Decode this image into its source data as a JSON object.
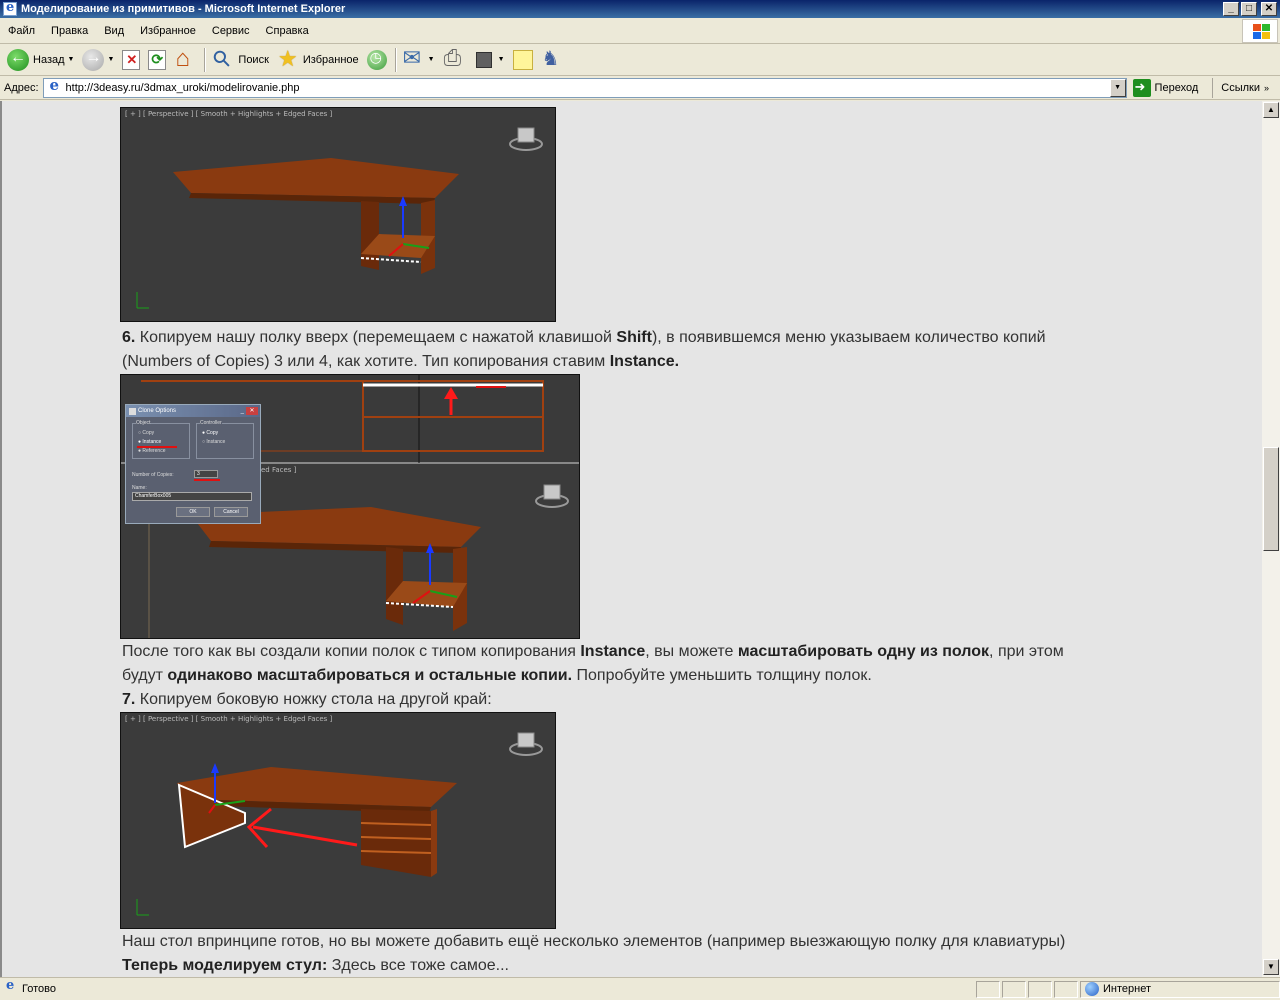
{
  "window": {
    "title": "Моделирование из примитивов - Microsoft Internet Explorer",
    "controls": [
      "_",
      "□",
      "✕"
    ]
  },
  "menu": [
    {
      "label": "Файл"
    },
    {
      "label": "Правка"
    },
    {
      "label": "Вид"
    },
    {
      "label": "Избранное"
    },
    {
      "label": "Сервис"
    },
    {
      "label": "Справка"
    }
  ],
  "toolbar": {
    "back_label": "Назад",
    "search_label": "Поиск",
    "favorites_label": "Избранное"
  },
  "address": {
    "label": "Адрес:",
    "url": "http://3deasy.ru/3dmax_uroki/modelirovanie.php",
    "go_label": "Переход",
    "links_label": "Ссылки"
  },
  "article": {
    "step6_num": "6.",
    "step6_a": " Копируем нашу полку вверх (перемещаем с нажатой клавишой ",
    "step6_shift": "Shift",
    "step6_b": "), в появившемся меню указываем количество копий",
    "step6_line2": "(Numbers of Copies) 3 или 4, как хотите. Тип копирования ставим ",
    "step6_instance": "Instance.",
    "after_a": "После того как вы создали копии полок с типом копирования ",
    "after_instance": "Instance",
    "after_b": ", вы можете ",
    "after_bold1": "масштабировать одну из полок",
    "after_c": ", при этом",
    "after_line2_a": "будут ",
    "after_bold2": "одинаково масштабироваться и остальные копии.",
    "after_line2_b": " Попробуйте уменьшить толщину полок.",
    "step7_num": "7.",
    "step7_text": " Копируем боковую ножку стола на другой край:",
    "final_line": "Наш стол впринципе готов, но вы можете добавить ещё несколько элементов (например выезжающую полку для клавиатуры)",
    "chair_bold": "Теперь моделируем стул:",
    "chair_text": " Здесь все тоже самое..."
  },
  "screenshots": {
    "vp_label": "[ + ] [ Perspective ] [ Smooth + Highlights + Edged Faces ]",
    "vp_label_partial": "ed Faces ]",
    "dialog": {
      "title": "Clone Options",
      "object_group": "Object",
      "opt_copy": "Copy",
      "opt_instance": "Instance",
      "opt_reference": "Reference",
      "controller_group": "Controller",
      "ctrl_copy": "Copy",
      "ctrl_instance": "Instance",
      "copies_label": "Number of Copies:",
      "copies_value": "3",
      "name_label": "Name:",
      "name_value": "ChamferBox005",
      "ok": "OK",
      "cancel": "Cancel"
    }
  },
  "status": {
    "text": "Готово",
    "zone": "Интернет"
  },
  "colors": {
    "wood": "#8a3a10",
    "viewport_bg": "#3b3b3b",
    "content_bg": "#e5e5e5"
  }
}
